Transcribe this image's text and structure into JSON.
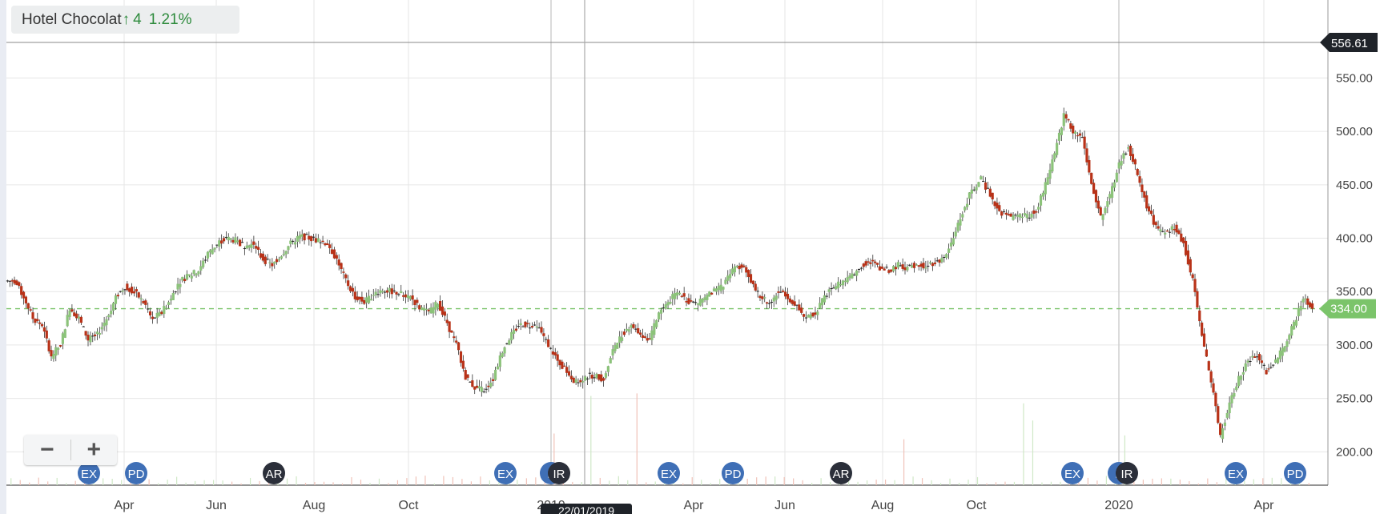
{
  "title": {
    "name": "Hotel Chocolat",
    "arrow": "↑",
    "change": "4",
    "change_pct": "1.21%"
  },
  "zoom": {
    "minus_label": "−",
    "plus_label": "+"
  },
  "price_tags": {
    "top": "556.61",
    "current": "334.00"
  },
  "crosshair_date": "22/01/2019",
  "colors": {
    "up": "#8cc37a",
    "down": "#b83218",
    "neutral": "#222222",
    "current_line": "#7bc46a",
    "grid": "#e6e6e6",
    "event_blue": "#3f6fb6",
    "event_dark": "#2b2f3a"
  },
  "chart_data": {
    "type": "candlestick",
    "x_ticks": [
      "Apr",
      "Jun",
      "Aug",
      "Oct",
      "2019",
      "Apr",
      "Jun",
      "Aug",
      "Oct",
      "2020",
      "Apr"
    ],
    "y_ticks": [
      "200.00",
      "250.00",
      "300.00",
      "350.00",
      "400.00",
      "450.00",
      "500.00",
      "550.00"
    ],
    "ylim": [
      180,
      560
    ],
    "current_price": 334.0,
    "series": [
      {
        "values": [
          360,
          345,
          325,
          318,
          290,
          300,
          335,
          325,
          305,
          310,
          325,
          345,
          355,
          350,
          340,
          325,
          330,
          345,
          360,
          365,
          370,
          385,
          395,
          400,
          398,
          392,
          395,
          380,
          375,
          385,
          395,
          402,
          400,
          398,
          395,
          380,
          360,
          345,
          340,
          348,
          352,
          350,
          348,
          345,
          335,
          330,
          340,
          320,
          300,
          270,
          260,
          258,
          268,
          295,
          310,
          320,
          318,
          315,
          300,
          285,
          275,
          265,
          270,
          272,
          268,
          295,
          310,
          320,
          310,
          305,
          330,
          340,
          350,
          342,
          338,
          345,
          350,
          355,
          370,
          375,
          360,
          345,
          340,
          350,
          345,
          335,
          325,
          330,
          345,
          355,
          360,
          365,
          375,
          378,
          372,
          370,
          375,
          372,
          376,
          374,
          378,
          380,
          400,
          425,
          445,
          455,
          440,
          425,
          420,
          420,
          421,
          425,
          450,
          480,
          515,
          500,
          495,
          450,
          420,
          440,
          470,
          485,
          460,
          430,
          410,
          405,
          410,
          395,
          360,
          310,
          265,
          215,
          245,
          270,
          285,
          290,
          275,
          285,
          300,
          320,
          345,
          334
        ]
      }
    ],
    "events": [
      {
        "label": "EX",
        "style": "blue"
      },
      {
        "label": "PD",
        "style": "blue"
      },
      {
        "label": "AR",
        "style": "dark"
      },
      {
        "label": "EX",
        "style": "blue"
      },
      {
        "label": "F",
        "style": "blue"
      },
      {
        "label": "IR",
        "style": "dark"
      },
      {
        "label": "EX",
        "style": "blue"
      },
      {
        "label": "PD",
        "style": "blue"
      },
      {
        "label": "AR",
        "style": "dark"
      },
      {
        "label": "EX",
        "style": "blue"
      },
      {
        "label": "F",
        "style": "blue"
      },
      {
        "label": "IR",
        "style": "dark"
      },
      {
        "label": "EX",
        "style": "blue"
      },
      {
        "label": "PD",
        "style": "blue"
      }
    ]
  }
}
